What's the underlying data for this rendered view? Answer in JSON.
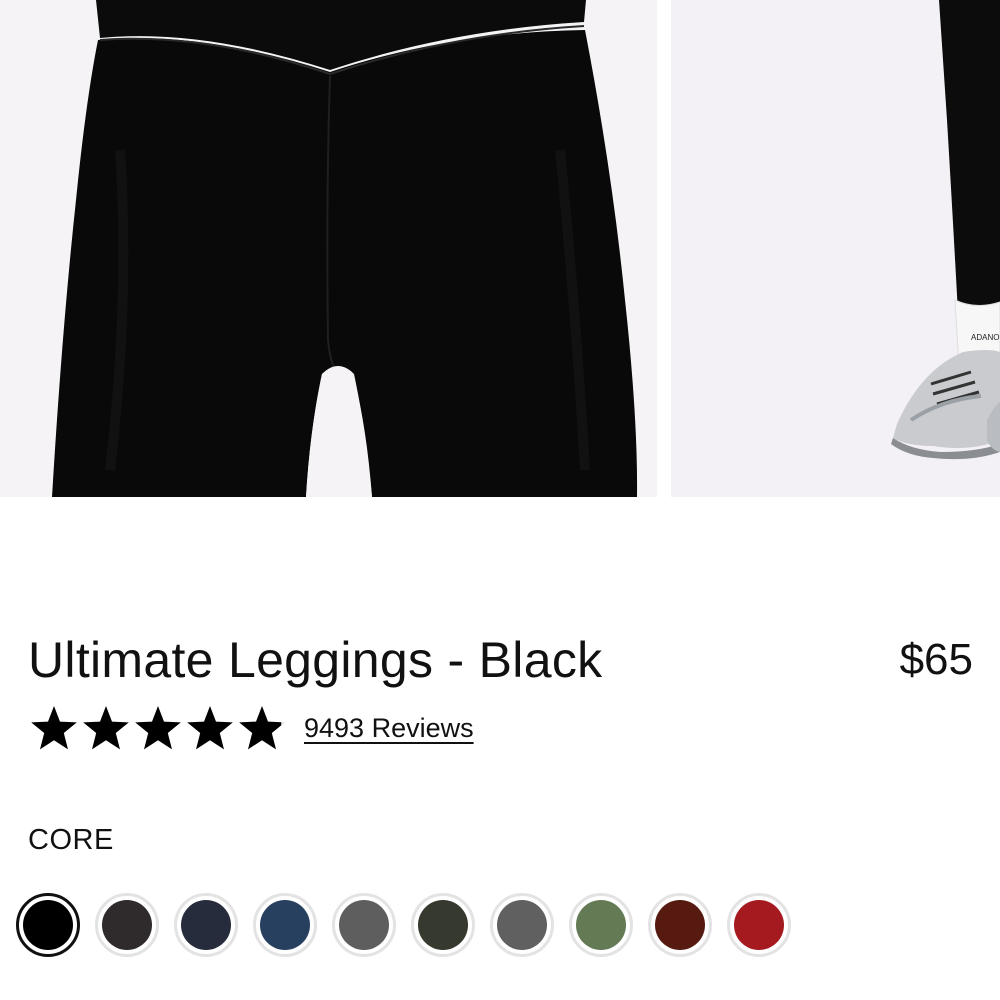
{
  "product": {
    "title": "Ultimate Leggings - Black",
    "price": "$65",
    "rating": 4.9,
    "reviews_label": "9493 Reviews"
  },
  "gallery": {
    "images": [
      {
        "name": "main-image-leggings-front-closeup"
      },
      {
        "name": "secondary-image-legs-sneakers",
        "sock_text": "ADANOL"
      }
    ]
  },
  "colors": {
    "collection_label": "CORE",
    "selected_index": 0,
    "swatches": [
      {
        "name": "black",
        "hex": "#000000"
      },
      {
        "name": "charcoal",
        "hex": "#2f2b2c"
      },
      {
        "name": "navy",
        "hex": "#262c3b"
      },
      {
        "name": "blue",
        "hex": "#27405f"
      },
      {
        "name": "grey",
        "hex": "#5e5e5e"
      },
      {
        "name": "olive-dark",
        "hex": "#36392d"
      },
      {
        "name": "slate-grey",
        "hex": "#606060"
      },
      {
        "name": "sage-green",
        "hex": "#647a55"
      },
      {
        "name": "maroon",
        "hex": "#561a10"
      },
      {
        "name": "red",
        "hex": "#a41a1f"
      }
    ]
  }
}
